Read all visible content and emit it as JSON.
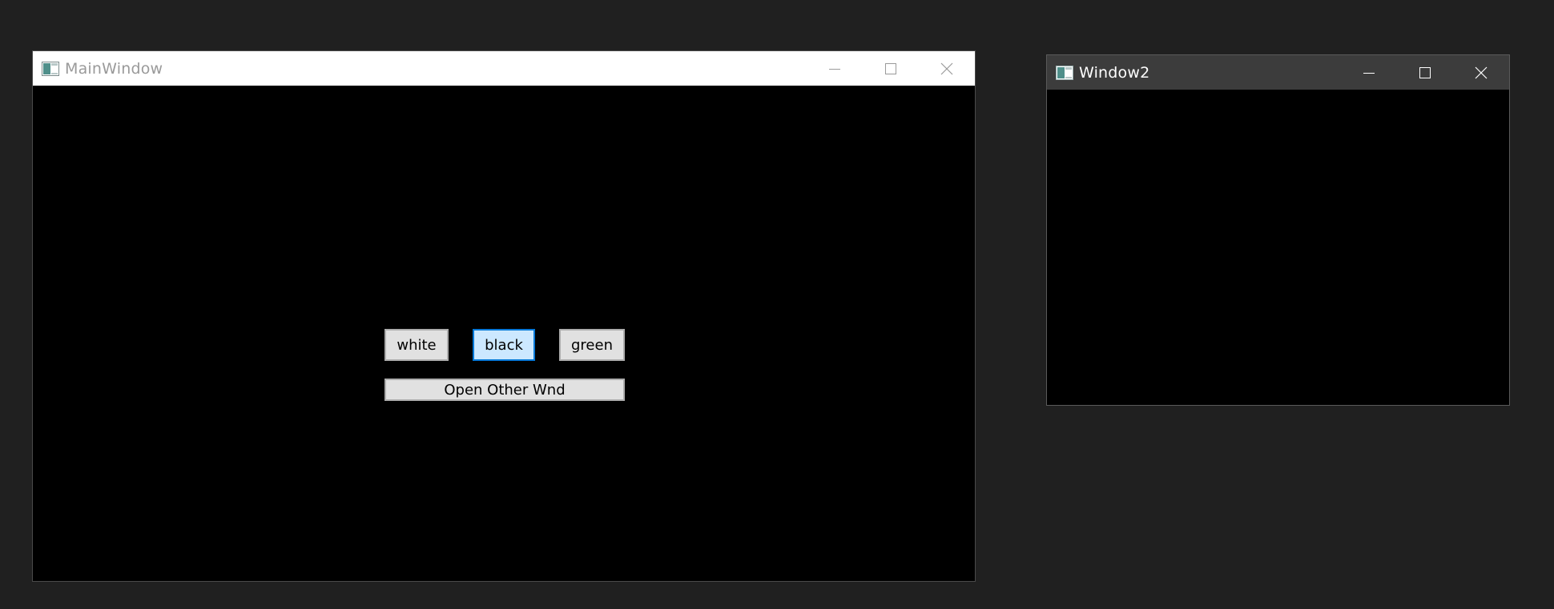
{
  "desktop": {
    "background": "#202020"
  },
  "main_window": {
    "title": "MainWindow",
    "icon": "app-window-icon",
    "active": false,
    "titlebar_color": "#ffffff",
    "client_color": "#000000",
    "controls": {
      "minimize_icon": "minimize-icon",
      "maximize_icon": "maximize-icon",
      "close_icon": "close-icon"
    },
    "buttons": {
      "white_label": "white",
      "black_label": "black",
      "green_label": "green",
      "open_other_label": "Open Other Wnd"
    },
    "hover_button": "black",
    "accent": "#0078d7"
  },
  "window2": {
    "title": "Window2",
    "icon": "app-window-icon",
    "active": true,
    "titlebar_color": "#3c3c3c",
    "client_color": "#000000",
    "controls": {
      "minimize_icon": "minimize-icon",
      "maximize_icon": "maximize-icon",
      "close_icon": "close-icon"
    }
  }
}
